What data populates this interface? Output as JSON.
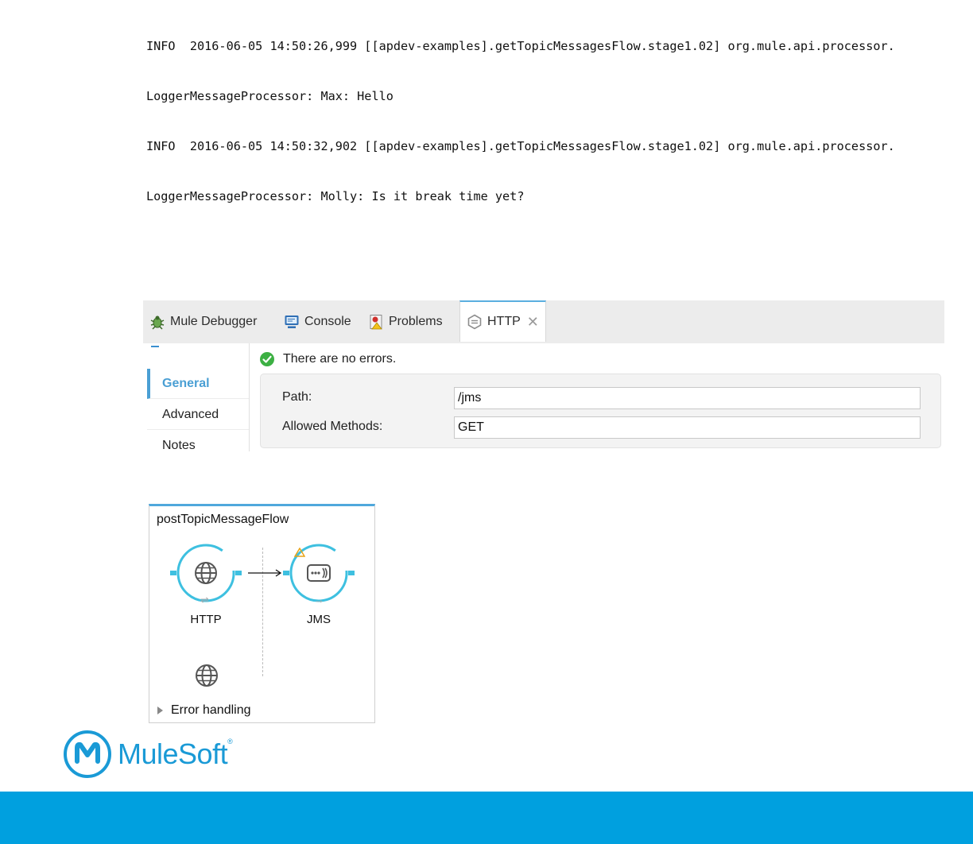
{
  "console": {
    "lines": [
      "INFO  2016-06-05 14:50:26,999 [[apdev-examples].getTopicMessagesFlow.stage1.02] org.mule.api.processor.",
      "LoggerMessageProcessor: Max: Hello",
      "INFO  2016-06-05 14:50:32,902 [[apdev-examples].getTopicMessagesFlow.stage1.02] org.mule.api.processor.",
      "LoggerMessageProcessor: Molly: Is it break time yet?"
    ]
  },
  "tabs": [
    {
      "label": "Mule Debugger",
      "icon": "bug-icon"
    },
    {
      "label": "Console",
      "icon": "console-icon"
    },
    {
      "label": "Problems",
      "icon": "problems-icon"
    },
    {
      "label": "HTTP",
      "icon": "http-connector-icon",
      "active": true
    }
  ],
  "properties": {
    "nav": [
      "General",
      "Advanced",
      "Notes"
    ],
    "status_text": "There are no errors.",
    "path_label": "Path:",
    "path_value": "/jms",
    "methods_label": "Allowed Methods:",
    "methods_value": "GET"
  },
  "flow": {
    "title": "postTopicMessageFlow",
    "nodes": [
      {
        "label": "HTTP",
        "icon": "globe-icon"
      },
      {
        "label": "JMS",
        "icon": "jms-icon"
      }
    ],
    "error_handling": "Error handling"
  },
  "brand": {
    "logo_text": "MuleSoft",
    "reg": "®",
    "accent": "#00a0df"
  }
}
